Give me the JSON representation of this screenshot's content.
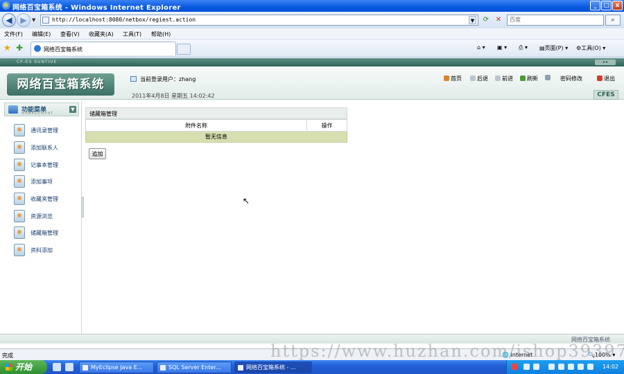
{
  "window": {
    "title": "网络百宝箱系统 - Windows Internet Explorer",
    "btn_min": "_",
    "btn_max": "□",
    "btn_close": "x"
  },
  "browser": {
    "url": "http://localhost:8080/netbox/regiest.action",
    "search_placeholder": "百度",
    "menu": [
      "文件(F)",
      "编辑(E)",
      "查看(V)",
      "收藏夹(A)",
      "工具(T)",
      "帮助(H)"
    ],
    "tab_title": "网络百宝箱系统",
    "cmd_page": "页面(P)",
    "cmd_tools": "工具(O)",
    "status_text": "完成",
    "zone": "Internet",
    "zoom": "100%"
  },
  "app": {
    "strip_brand": "CF-ES SUNTIVE",
    "logo": "网络百宝箱系统",
    "user_label": "当前登录用户：",
    "user_name": "zhang",
    "date": "2011年4月8日 星期五 14:02:42",
    "links": {
      "home": "首页",
      "back": "后退",
      "forward": "前进",
      "refresh": "刷新",
      "change_pwd": "密码修改",
      "logout": "退出"
    },
    "badge": "CFES",
    "footer": "网络百宝箱系统",
    "sidebar": {
      "title": "功能菜单",
      "subtitle": "MANAGEMENT",
      "items": [
        "通讯录管理",
        "添加联系人",
        "记事本管理",
        "添加事项",
        "收藏夹管理",
        "资源浏览",
        "储藏箱管理",
        "资料添加"
      ]
    },
    "panel": {
      "title": "储藏箱管理",
      "col_name": "附件名称",
      "col_action": "操作",
      "empty": "暂无信息",
      "add_button": "追加"
    }
  },
  "watermark": "https://www.huzhan.com/ishop39397",
  "taskbar": {
    "start": "开始",
    "tasks": [
      "MyEclipse Java E...",
      "SQL Server Enter...",
      "网络百宝箱系统 - ..."
    ],
    "clock": "14:02"
  },
  "colors": {
    "xp_blue": "#0a5ae0",
    "app_green": "#3c7165",
    "empty_row": "#d7dfb0"
  }
}
